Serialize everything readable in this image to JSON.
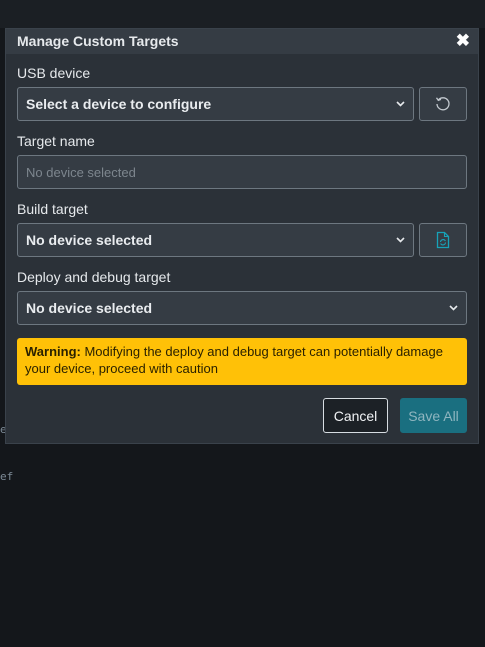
{
  "dialog": {
    "title": "Manage Custom Targets",
    "close_symbol": "✖"
  },
  "usb_device": {
    "label": "USB device",
    "value": "Select a device to configure",
    "refresh_icon": "refresh-icon"
  },
  "target_name": {
    "label": "Target name",
    "placeholder": "No device selected"
  },
  "build_target": {
    "label": "Build target",
    "value": "No device selected",
    "action_icon": "file-sync-icon"
  },
  "deploy_target": {
    "label": "Deploy and debug target",
    "value": "No device selected"
  },
  "warning": {
    "strong": "Warning:",
    "text": " Modifying the deploy and debug target can potentially damage your device, proceed with caution"
  },
  "buttons": {
    "cancel": "Cancel",
    "save": "Save All"
  },
  "background": {
    "fragment_1": "e",
    "fragment_2": "ef"
  },
  "colors": {
    "dialog_bg": "#2b3138",
    "warning_bg": "#ffc107",
    "save_bg": "#1a6f80",
    "accent_icon": "#17a2b8"
  }
}
